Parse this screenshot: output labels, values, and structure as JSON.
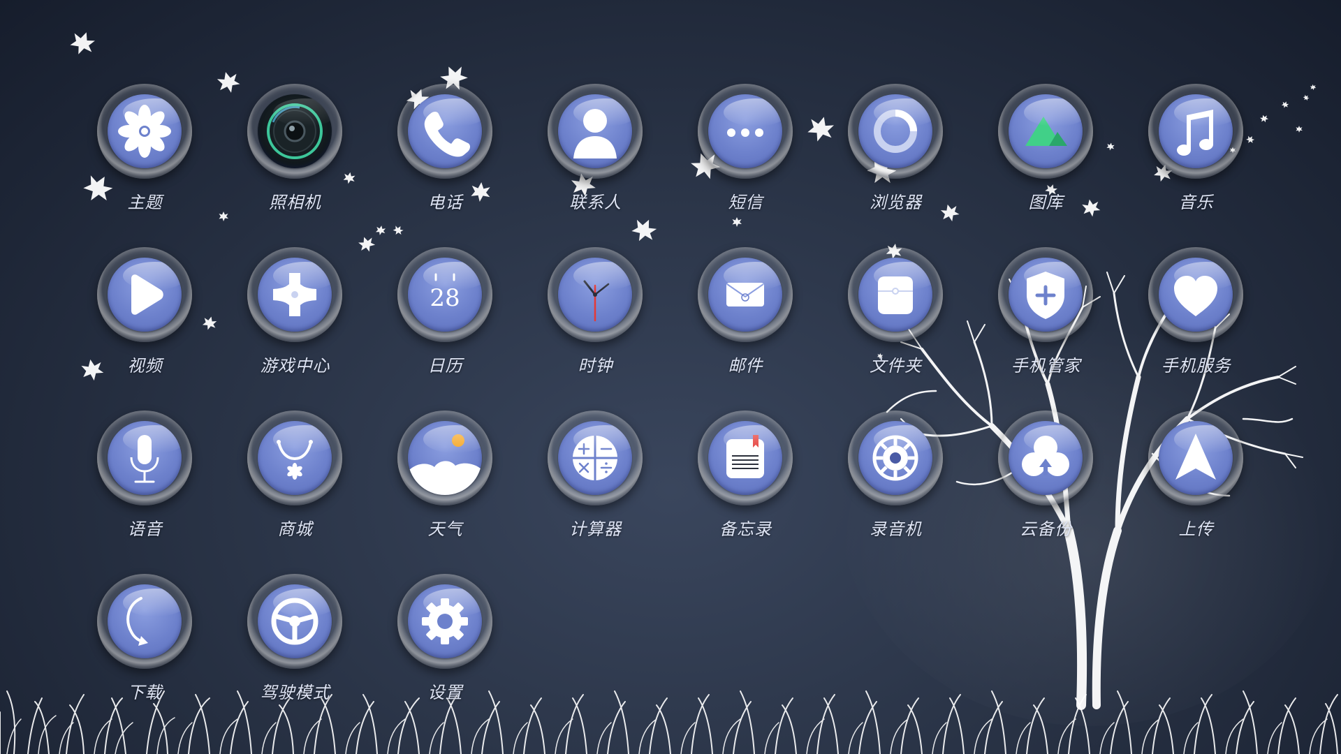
{
  "theme": {
    "accent": "#6d81cc",
    "label_color": "#dfe5f5"
  },
  "apps": [
    {
      "id": "theme",
      "label": "主题",
      "icon": "flower-icon"
    },
    {
      "id": "camera",
      "label": "照相机",
      "icon": "camera-lens-icon"
    },
    {
      "id": "phone",
      "label": "电话",
      "icon": "phone-handset-icon"
    },
    {
      "id": "contacts",
      "label": "联系人",
      "icon": "person-icon"
    },
    {
      "id": "messages",
      "label": "短信",
      "icon": "dots-icon"
    },
    {
      "id": "browser",
      "label": "浏览器",
      "icon": "browser-ring-icon"
    },
    {
      "id": "gallery",
      "label": "图库",
      "icon": "mountain-icon"
    },
    {
      "id": "music",
      "label": "音乐",
      "icon": "music-note-icon"
    },
    {
      "id": "video",
      "label": "视频",
      "icon": "play-icon"
    },
    {
      "id": "game-center",
      "label": "游戏中心",
      "icon": "gamepad-icon"
    },
    {
      "id": "calendar",
      "label": "日历",
      "icon": "calendar-icon",
      "day": "28"
    },
    {
      "id": "clock",
      "label": "时钟",
      "icon": "clock-icon"
    },
    {
      "id": "mail",
      "label": "邮件",
      "icon": "envelope-icon"
    },
    {
      "id": "files",
      "label": "文件夹",
      "icon": "folder-icon"
    },
    {
      "id": "phone-manager",
      "label": "手机管家",
      "icon": "shield-plus-icon"
    },
    {
      "id": "phone-service",
      "label": "手机服务",
      "icon": "heart-icon"
    },
    {
      "id": "voice",
      "label": "语音",
      "icon": "microphone-icon"
    },
    {
      "id": "store",
      "label": "商城",
      "icon": "store-smile-icon"
    },
    {
      "id": "weather",
      "label": "天气",
      "icon": "weather-cloud-sun-icon"
    },
    {
      "id": "calculator",
      "label": "计算器",
      "icon": "calculator-icon"
    },
    {
      "id": "notes",
      "label": "备忘录",
      "icon": "notepad-icon"
    },
    {
      "id": "recorder",
      "label": "录音机",
      "icon": "recorder-reel-icon"
    },
    {
      "id": "cloud-backup",
      "label": "云备份",
      "icon": "cloud-upload-icon"
    },
    {
      "id": "upload",
      "label": "上传",
      "icon": "navigation-arrow-icon"
    },
    {
      "id": "download",
      "label": "下载",
      "icon": "moon-arrow-icon"
    },
    {
      "id": "driving-mode",
      "label": "驾驶模式",
      "icon": "steering-wheel-icon"
    },
    {
      "id": "settings",
      "label": "设置",
      "icon": "gear-icon"
    }
  ]
}
